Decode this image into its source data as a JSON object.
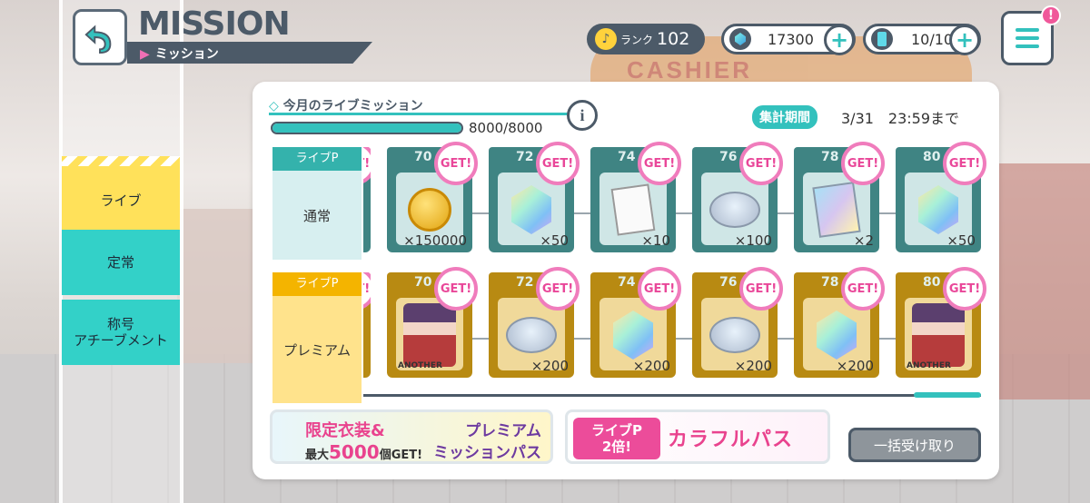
{
  "header": {
    "title": "MISSION",
    "subtitle": "ミッション",
    "rank_label": "ランク",
    "rank_value": "102",
    "gems": "17300",
    "energy": "10/10",
    "alert": "!"
  },
  "tabs": [
    "ライブ",
    "定常",
    "称号\nアチーブメント"
  ],
  "panel": {
    "title": "今月のライブミッション",
    "progress_text": "8000/8000",
    "progress_fraction": 1.0,
    "period_label": "集計期間",
    "period_value": "3/31　23:59まで",
    "row_header": "ライブP",
    "row_normal": "通常",
    "row_premium": "プレミアム",
    "get_label": "GET!",
    "normal_items": [
      {
        "top": "",
        "qty": "",
        "icon": "ticket"
      },
      {
        "top": "70",
        "qty": "×150000",
        "icon": "coin"
      },
      {
        "top": "72",
        "qty": "×50",
        "icon": "gem"
      },
      {
        "top": "74",
        "qty": "×10",
        "icon": "score"
      },
      {
        "top": "76",
        "qty": "×100",
        "icon": "ticket"
      },
      {
        "top": "78",
        "qty": "×2",
        "icon": "skill"
      },
      {
        "top": "80",
        "qty": "×50",
        "icon": "gem"
      }
    ],
    "premium_items": [
      {
        "top": "",
        "qty": "",
        "icon": "ticket"
      },
      {
        "top": "70",
        "qty": "",
        "icon": "character",
        "tag": "ANOTHER"
      },
      {
        "top": "72",
        "qty": "×200",
        "icon": "ticket"
      },
      {
        "top": "74",
        "qty": "×200",
        "icon": "gem"
      },
      {
        "top": "76",
        "qty": "×200",
        "icon": "ticket"
      },
      {
        "top": "78",
        "qty": "×200",
        "icon": "gem"
      },
      {
        "top": "80",
        "qty": "",
        "icon": "character",
        "tag": "ANOTHER"
      }
    ]
  },
  "banners": {
    "b1_line1": "限定衣装&",
    "b1_line2_pre": "最大",
    "b1_line2_num": "5000",
    "b1_line2_post": "個GET!",
    "b1_right1": "プレミアム",
    "b1_right2": "ミッションパス",
    "b2_box1": "ライブP",
    "b2_box2": "2倍!",
    "b2_pass": "カラフルパス"
  },
  "buttons": {
    "collect_all": "一括受け取り"
  },
  "bg_sign": "CASHIER",
  "colors": {
    "accent": "#33c1bd",
    "dark": "#4c5a68",
    "pink": "#e9438e",
    "gold": "#f4b400"
  }
}
